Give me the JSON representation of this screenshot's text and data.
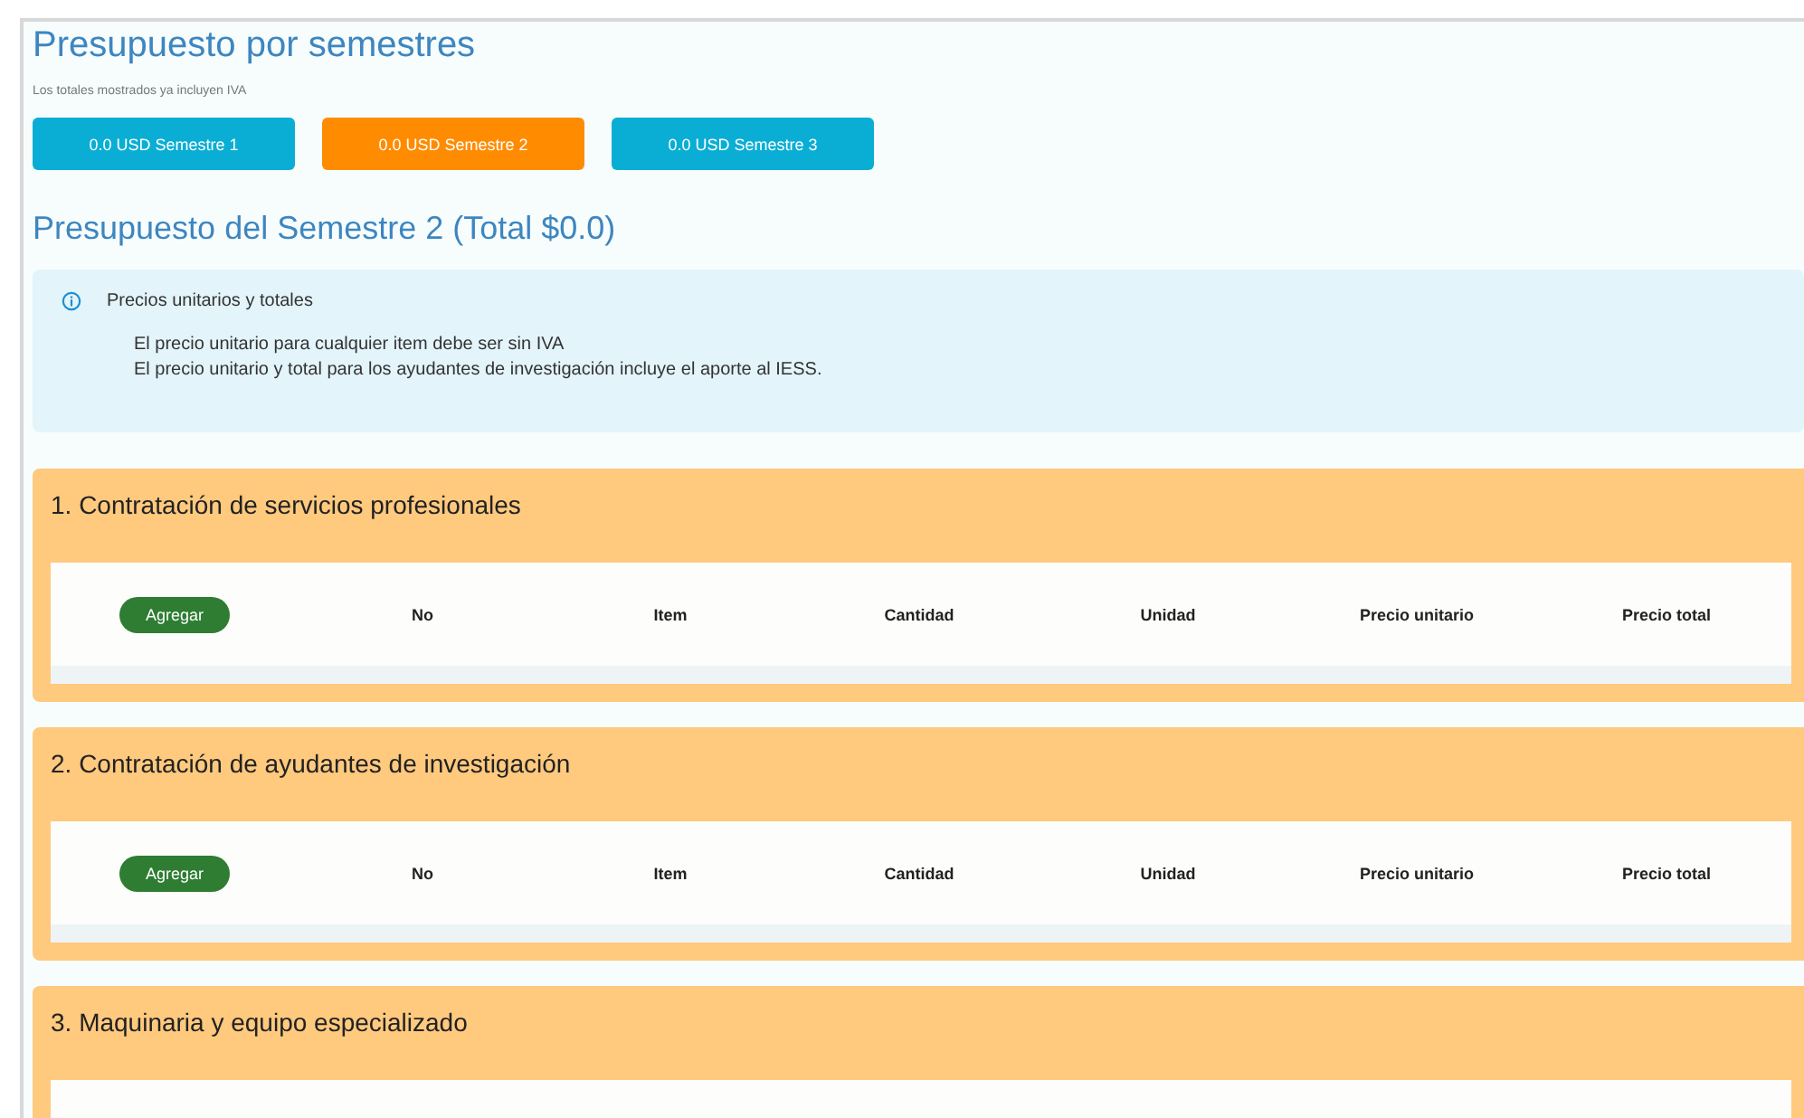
{
  "title": "Presupuesto por semestres",
  "subtitle": "Los totales mostrados ya incluyen IVA",
  "semesters": [
    {
      "label": "0.0 USD Semestre 1",
      "selected": false
    },
    {
      "label": "0.0 USD Semestre 2",
      "selected": true
    },
    {
      "label": "0.0 USD Semestre 3",
      "selected": false
    }
  ],
  "semester_title": "Presupuesto del Semestre 2 (Total $0.0)",
  "info": {
    "title": "Precios unitarios y totales",
    "lines": [
      "El precio unitario para cualquier item debe ser sin IVA",
      "El precio unitario y total para los ayudantes de investigación incluye el aporte al IESS."
    ]
  },
  "sections": [
    {
      "title": "1. Contratación de servicios profesionales",
      "add_button": "Agregar",
      "columns": [
        "No",
        "Item",
        "Cantidad",
        "Unidad",
        "Precio unitario",
        "Precio total"
      ]
    },
    {
      "title": "2. Contratación de ayudantes de investigación",
      "add_button": "Agregar",
      "columns": [
        "No",
        "Item",
        "Cantidad",
        "Unidad",
        "Precio unitario",
        "Precio total"
      ]
    },
    {
      "title": "3. Maquinaria y equipo especializado"
    }
  ]
}
